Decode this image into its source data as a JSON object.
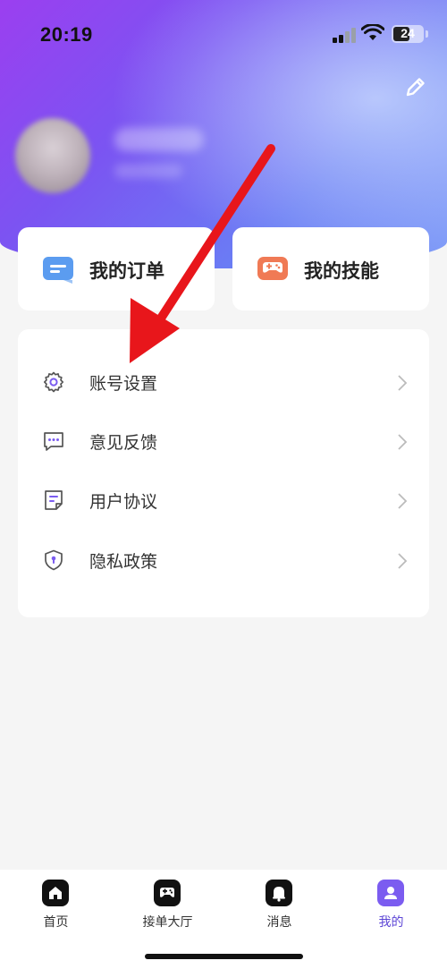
{
  "status_bar": {
    "time": "20:19",
    "battery": "24",
    "icons": [
      "signal-icon",
      "wifi-icon",
      "battery-icon"
    ]
  },
  "header": {
    "edit_icon": "edit-pencil-icon"
  },
  "quick_cards": [
    {
      "label": "我的订单",
      "icon": "order-list-icon",
      "color": "#5b9cf0"
    },
    {
      "label": "我的技能",
      "icon": "gamepad-icon",
      "color": "#f07a55"
    }
  ],
  "menu": {
    "items": [
      {
        "label": "账号设置",
        "icon": "gear-icon"
      },
      {
        "label": "意见反馈",
        "icon": "chat-bubble-icon"
      },
      {
        "label": "用户协议",
        "icon": "document-icon"
      },
      {
        "label": "隐私政策",
        "icon": "shield-icon"
      }
    ]
  },
  "tab_bar": {
    "tabs": [
      {
        "label": "首页",
        "icon": "home-icon",
        "active": false
      },
      {
        "label": "接单大厅",
        "icon": "gamepad-icon",
        "active": false
      },
      {
        "label": "消息",
        "icon": "bell-icon",
        "active": false
      },
      {
        "label": "我的",
        "icon": "person-icon",
        "active": true
      }
    ]
  },
  "colors": {
    "accent": "#7b5cf0",
    "annotation_arrow": "#e8161b",
    "hero_gradient_start": "#9b3ff0",
    "hero_gradient_end": "#7f9cf8"
  }
}
